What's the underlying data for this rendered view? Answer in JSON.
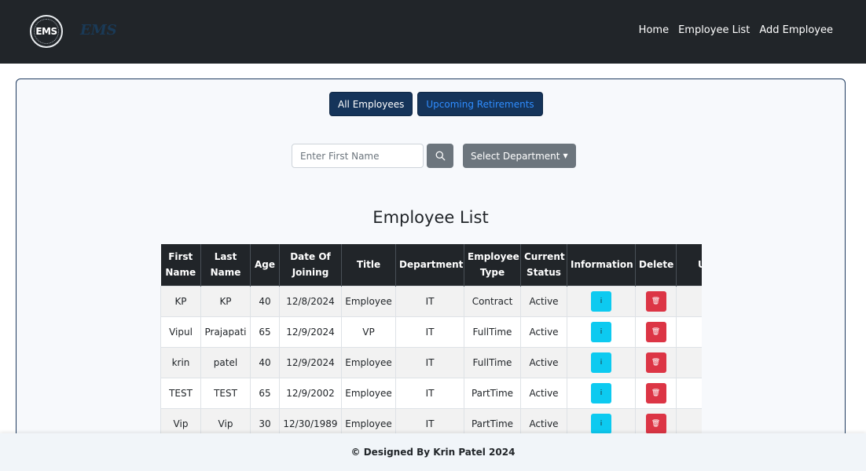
{
  "navbar": {
    "logo_text": "EMS",
    "brand": "EMS",
    "links": [
      "Home",
      "Employee List",
      "Add Employee"
    ]
  },
  "tabs": {
    "all_label": "All Employees",
    "retire_label": "Upcoming Retirements"
  },
  "search": {
    "placeholder": "Enter First Name",
    "value": ""
  },
  "department_dropdown": {
    "label": "Select Department"
  },
  "page_title": "Employee List",
  "table": {
    "headers": [
      [
        "First",
        "Name"
      ],
      [
        "Last",
        "Name"
      ],
      [
        "Age"
      ],
      [
        "Date Of",
        "Joining"
      ],
      [
        "Title"
      ],
      [
        "Department"
      ],
      [
        "Employee",
        "Type"
      ],
      [
        "Current",
        "Status"
      ],
      [
        "Information"
      ],
      [
        "Delete"
      ],
      [
        "Update"
      ]
    ],
    "rows": [
      {
        "first": "KP",
        "last": "KP",
        "age": "40",
        "doj": "12/8/2024",
        "title": "Employee",
        "dept": "IT",
        "type": "Contract",
        "status": "Active"
      },
      {
        "first": "Vipul",
        "last": "Prajapati",
        "age": "65",
        "doj": "12/9/2024",
        "title": "VP",
        "dept": "IT",
        "type": "FullTime",
        "status": "Active"
      },
      {
        "first": "krin",
        "last": "patel",
        "age": "40",
        "doj": "12/9/2024",
        "title": "Employee",
        "dept": "IT",
        "type": "FullTime",
        "status": "Active"
      },
      {
        "first": "TEST",
        "last": "TEST",
        "age": "65",
        "doj": "12/9/2002",
        "title": "Employee",
        "dept": "IT",
        "type": "PartTime",
        "status": "Active"
      },
      {
        "first": "Vip",
        "last": "Vip",
        "age": "30",
        "doj": "12/30/1989",
        "title": "Employee",
        "dept": "IT",
        "type": "PartTime",
        "status": "Active"
      }
    ],
    "action_icons": {
      "info": "info-icon",
      "delete": "trash-icon",
      "update": "edit-icon"
    }
  },
  "footer": {
    "text": "© Designed By Krin Patel 2024"
  },
  "colors": {
    "navbar_bg": "#212529",
    "primary_dark": "#15345a",
    "info": "#0dcaf0",
    "danger": "#dc3545",
    "success": "#198754",
    "secondary": "#6c757d"
  }
}
